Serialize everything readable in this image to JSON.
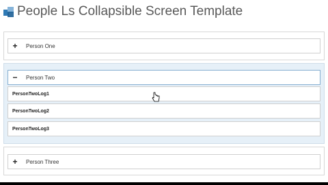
{
  "app": {
    "title": "People Ls Collapsible Screen Template",
    "logo_icon": "stacked-squares-logo"
  },
  "groups": [
    {
      "label": "Person One",
      "expanded": false,
      "toggle": "+"
    },
    {
      "label": "Person Two",
      "expanded": true,
      "toggle": "−",
      "items": [
        "PersonTwoLog1",
        "PersonTwoLog2",
        "PersonTwoLog3"
      ]
    },
    {
      "label": "Person Three",
      "expanded": false,
      "toggle": "+"
    }
  ],
  "colors": {
    "expanded_background": "#e6f0f8",
    "title_text": "#595959",
    "logo_blue": "#2f7ab5"
  }
}
